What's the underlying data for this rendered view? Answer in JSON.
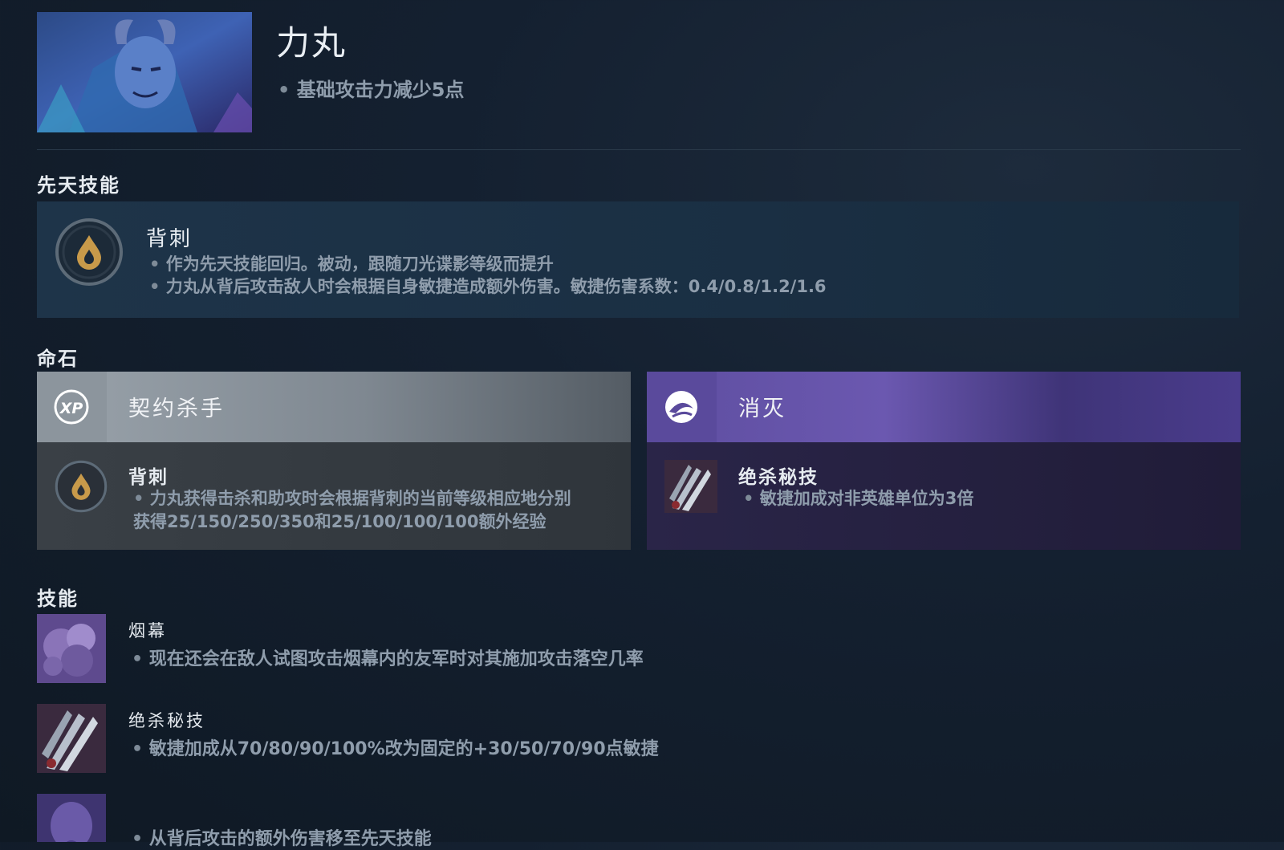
{
  "hero": {
    "name": "力丸",
    "note": "基础攻击力减少5点"
  },
  "innate": {
    "section_title": "先天技能",
    "name": "背刺",
    "lines": [
      "作为先天技能回归。被动，跟随刀光谍影等级而提升",
      "力丸从背后攻击敌人时会根据自身敏捷造成额外伤害。敏捷伤害系数：0.4/0.8/1.2/1.6"
    ]
  },
  "facets": {
    "section_title": "命石",
    "items": [
      {
        "title": "契约杀手",
        "icon": "xp-icon",
        "ability_name": "背刺",
        "ability_icon": "backstab-icon",
        "desc": "力丸获得击杀和助攻时会根据背刺的当前等级相应地分别获得25/150/250/350和25/100/100/100额外经验"
      },
      {
        "title": "消灭",
        "icon": "swirl-icon",
        "ability_name": "绝杀秘技",
        "ability_icon": "daggers-icon",
        "desc": "敏捷加成对非英雄单位为3倍"
      }
    ],
    "colors": {
      "left_head": "#8d969f",
      "right_head": "#5a4a9c"
    }
  },
  "abilities": {
    "section_title": "技能",
    "items": [
      {
        "name": "烟幕",
        "icon": "smoke-screen-icon",
        "desc": "现在还会在敌人试图攻击烟幕内的友军时对其施加攻击落空几率"
      },
      {
        "name": "绝杀秘技",
        "icon": "daggers-icon",
        "desc": "敏捷加成从70/80/90/100%改为固定的+30/50/70/90点敏捷"
      },
      {
        "name": "",
        "icon": "cloak-icon",
        "desc": "从背后攻击的额外伤害移至先天技能"
      }
    ]
  }
}
